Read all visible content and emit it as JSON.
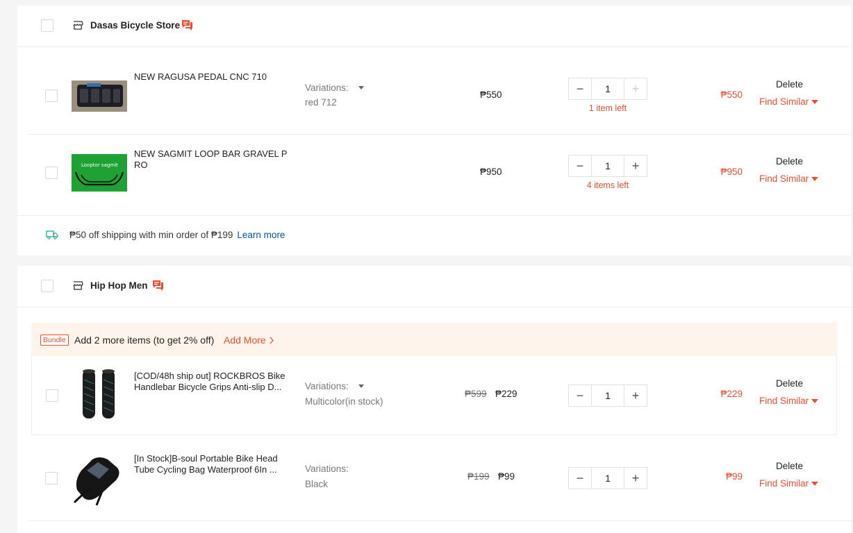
{
  "shops": [
    {
      "name": "Dasas Bicycle Store",
      "items": [
        {
          "name": "NEW RAGUSA PEDAL CNC 710",
          "variations_label": "Variations:",
          "variation_value": "red 712",
          "price": "₱550",
          "quantity": "1",
          "stock": "1 item left",
          "total": "₱550",
          "delete": "Delete",
          "find_similar": "Find Similar"
        },
        {
          "name": "NEW SAGMIT LOOP BAR GRAVEL PRO",
          "price": "₱950",
          "quantity": "1",
          "stock": "4 items left",
          "total": "₱950",
          "delete": "Delete",
          "find_similar": "Find Similar",
          "thumb_text": "Looptor sagmit"
        }
      ],
      "shipping": {
        "text": "₱50 off shipping with min order of ₱199",
        "link": "Learn more"
      }
    },
    {
      "name": "Hip Hop Men",
      "bundle": {
        "tag": "Bundle",
        "text": "Add 2 more items (to get 2% off)",
        "add_more": "Add More"
      },
      "items": [
        {
          "name": "[COD/48h ship out] ROCKBROS Bike Handlebar Bicycle Grips Anti-slip D...",
          "variations_label": "Variations:",
          "variation_value": "Multicolor(in stock)",
          "old_price": "₱599",
          "price": "₱229",
          "quantity": "1",
          "total": "₱229",
          "delete": "Delete",
          "find_similar": "Find Similar"
        },
        {
          "name": "[In Stock]B-soul Portable Bike Head Tube Cycling Bag Waterproof 6In ...",
          "variations_label": "Variations:",
          "variation_value": "Black",
          "old_price": "₱199",
          "price": "₱99",
          "quantity": "1",
          "total": "₱99",
          "delete": "Delete",
          "find_similar": "Find Similar"
        }
      ]
    }
  ],
  "colors": {
    "accent": "#ee4d2d",
    "link": "#0055aa",
    "bundle_bg": "#fff4ec"
  }
}
